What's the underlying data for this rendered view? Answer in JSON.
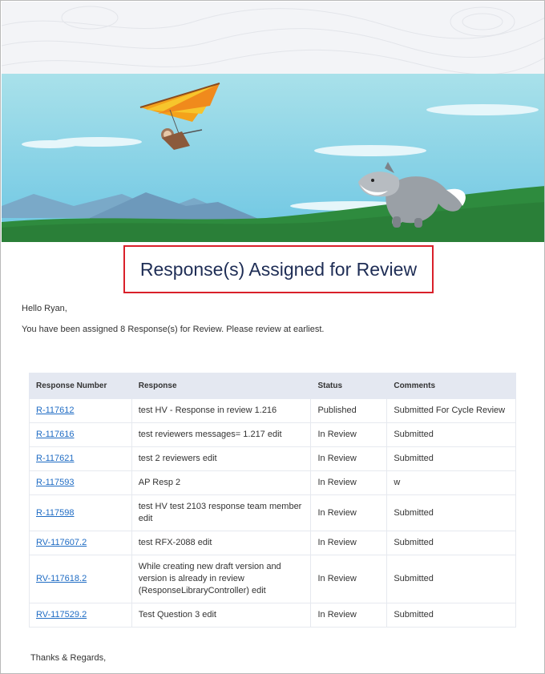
{
  "header": {
    "title": "Response(s) Assigned for Review"
  },
  "body": {
    "greeting": "Hello Ryan,",
    "intro": "You have been assigned 8 Response(s) for Review. Please review at earliest.",
    "signoff": "Thanks & Regards,"
  },
  "table": {
    "headers": [
      "Response Number",
      "Response",
      "Status",
      "Comments"
    ],
    "rows": [
      {
        "number": "R-117612",
        "response": "test HV - Response in review 1.216",
        "status": "Published",
        "comments": "Submitted For Cycle Review"
      },
      {
        "number": "R-117616",
        "response": "test reviewers messages= 1.217 edit",
        "status": "In Review",
        "comments": "Submitted"
      },
      {
        "number": "R-117621",
        "response": "test 2 reviewers edit",
        "status": "In Review",
        "comments": "Submitted"
      },
      {
        "number": "R-117593",
        "response": "AP Resp 2",
        "status": "In Review",
        "comments": "w"
      },
      {
        "number": "R-117598",
        "response": "test HV test 2103 response team member edit",
        "status": "In Review",
        "comments": "Submitted"
      },
      {
        "number": "RV-117607.2",
        "response": "test RFX-2088 edit",
        "status": "In Review",
        "comments": "Submitted"
      },
      {
        "number": "RV-117618.2",
        "response": "While creating new draft version and version is already in review (ResponseLibraryController) edit",
        "status": "In Review",
        "comments": "Submitted"
      },
      {
        "number": "RV-117529.2",
        "response": "Test Question 3 edit",
        "status": "In Review",
        "comments": "Submitted"
      }
    ]
  },
  "colors": {
    "title": "#1e2d55",
    "highlight_border": "#d9202a",
    "link": "#1f6cc4",
    "table_header_bg": "#e4e8f1",
    "sky": "#9fdcea",
    "grass": "#2e8b3e"
  },
  "icons": {
    "banner": "hang-glider-and-wolf-illustration"
  }
}
